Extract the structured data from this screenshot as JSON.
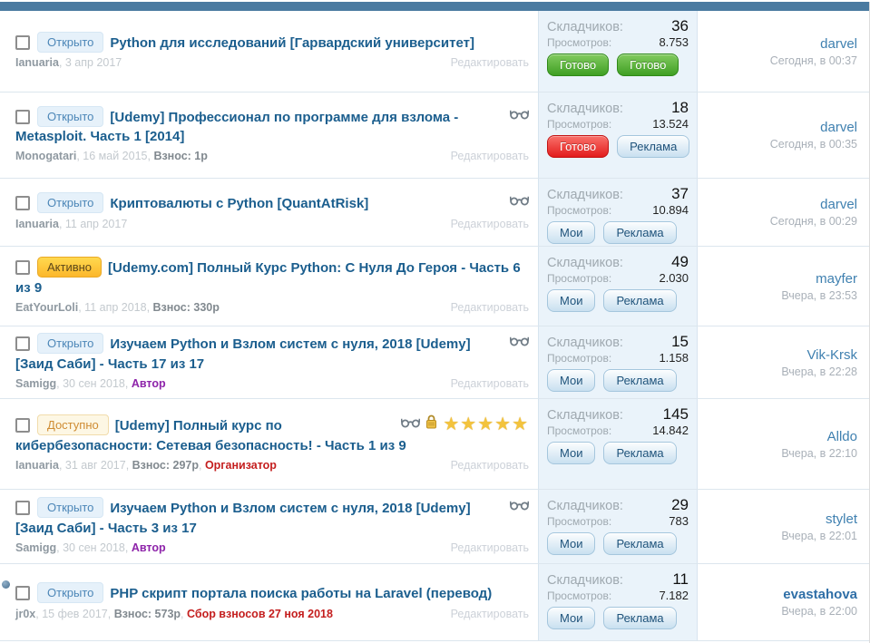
{
  "labels": {
    "skladchikov": "Складчиков:",
    "prosmotrov": "Просмотров:",
    "edit": "Редактировать"
  },
  "colors": {
    "topbar": "#4a7aa0",
    "title_link": "#1b5e8e",
    "username_link": "#3f80b0",
    "stats_bg": "#eaf3fa",
    "status_open_text": "#4d87b8",
    "status_active_bg": "#fcc53d",
    "status_available_text": "#cf8c33",
    "button_green": "#3f9f23",
    "button_red": "#e31c1c",
    "star_gold": "#f3c33d"
  },
  "threads": [
    {
      "unread": false,
      "status": "Открыто",
      "status_type": "open",
      "title": "Python для исследований [Гарвардский университет]",
      "icons": [],
      "meta": [
        {
          "text": "Ianuaria",
          "style": "author"
        },
        {
          "text": ", 3 апр 2017",
          "style": "date"
        }
      ],
      "stats": {
        "skladchikov": "36",
        "prosmotrov": "8.753"
      },
      "buttons": [
        {
          "label": "Готово",
          "style": "green"
        },
        {
          "label": "Готово",
          "style": "green"
        }
      ],
      "user": "darvel",
      "user_bold": false,
      "time": "Сегодня, в 00:37"
    },
    {
      "unread": false,
      "status": "Открыто",
      "status_type": "open",
      "title": "[Udemy] Профессионал по программе для взлома - Metasploit. Часть 1 [2014]",
      "icons": [
        {
          "type": "glasses"
        }
      ],
      "meta": [
        {
          "text": "Monogatari",
          "style": "author"
        },
        {
          "text": ", 16 май 2015, ",
          "style": "date"
        },
        {
          "text": "Взнос: 1р",
          "style": "vznos"
        }
      ],
      "stats": {
        "skladchikov": "18",
        "prosmotrov": "13.524"
      },
      "buttons": [
        {
          "label": "Готово",
          "style": "red"
        },
        {
          "label": "Реклама",
          "style": "blue"
        }
      ],
      "user": "darvel",
      "user_bold": false,
      "time": "Сегодня, в 00:35"
    },
    {
      "unread": false,
      "status": "Открыто",
      "status_type": "open",
      "title": "Криптовалюты с Python [QuantAtRisk]",
      "icons": [
        {
          "type": "glasses"
        }
      ],
      "meta": [
        {
          "text": "Ianuaria",
          "style": "author"
        },
        {
          "text": ", 11 апр 2017",
          "style": "date"
        }
      ],
      "stats": {
        "skladchikov": "37",
        "prosmotrov": "10.894"
      },
      "buttons": [
        {
          "label": "Мои",
          "style": "blue"
        },
        {
          "label": "Реклама",
          "style": "blue"
        }
      ],
      "user": "darvel",
      "user_bold": false,
      "time": "Сегодня, в 00:29"
    },
    {
      "unread": false,
      "status": "Активно",
      "status_type": "active",
      "title": "[Udemy.com] Полный Курс Python: С Нуля До Героя - Часть 6 из 9",
      "icons": [],
      "meta": [
        {
          "text": "EatYourLoli",
          "style": "author"
        },
        {
          "text": ", 11 апр 2018, ",
          "style": "date"
        },
        {
          "text": "Взнос: 330р",
          "style": "vznos"
        }
      ],
      "stats": {
        "skladchikov": "49",
        "prosmotrov": "2.030"
      },
      "buttons": [
        {
          "label": "Мои",
          "style": "blue"
        },
        {
          "label": "Реклама",
          "style": "blue"
        }
      ],
      "user": "mayfer",
      "user_bold": false,
      "time": "Вчера, в 23:53"
    },
    {
      "unread": false,
      "status": "Открыто",
      "status_type": "open",
      "title": "Изучаем Python и Взлом систем с нуля, 2018 [Udemy] [Заид Саби] - Часть 17 из 17",
      "icons": [
        {
          "type": "glasses"
        }
      ],
      "meta": [
        {
          "text": "Samigg",
          "style": "author"
        },
        {
          "text": ", 30 сен 2018, ",
          "style": "date"
        },
        {
          "text": "Автор",
          "style": "purple"
        }
      ],
      "stats": {
        "skladchikov": "15",
        "prosmotrov": "1.158"
      },
      "buttons": [
        {
          "label": "Мои",
          "style": "blue"
        },
        {
          "label": "Реклама",
          "style": "blue"
        }
      ],
      "user": "Vik-Krsk",
      "user_bold": false,
      "time": "Вчера, в 22:28"
    },
    {
      "unread": false,
      "status": "Доступно",
      "status_type": "available",
      "title": "[Udemy] Полный курс по кибербезопасности: Сетевая безопасность! - Часть 1 из 9",
      "icons": [
        {
          "type": "glasses"
        },
        {
          "type": "lock"
        },
        {
          "type": "stars",
          "count": 5
        }
      ],
      "meta": [
        {
          "text": "Ianuaria",
          "style": "author"
        },
        {
          "text": ", 31 авг 2017, ",
          "style": "date"
        },
        {
          "text": "Взнос: 297р",
          "style": "vznos"
        },
        {
          "text": ", ",
          "style": "date"
        },
        {
          "text": "Организатор",
          "style": "red"
        }
      ],
      "stats": {
        "skladchikov": "145",
        "prosmotrov": "14.842"
      },
      "buttons": [
        {
          "label": "Мои",
          "style": "blue"
        },
        {
          "label": "Реклама",
          "style": "blue"
        }
      ],
      "user": "Alldo",
      "user_bold": false,
      "time": "Вчера, в 22:10"
    },
    {
      "unread": false,
      "status": "Открыто",
      "status_type": "open",
      "title": "Изучаем Python и Взлом систем с нуля, 2018 [Udemy] [Заид Саби] - Часть 3 из 17",
      "icons": [
        {
          "type": "glasses"
        }
      ],
      "meta": [
        {
          "text": "Samigg",
          "style": "author"
        },
        {
          "text": ", 30 сен 2018, ",
          "style": "date"
        },
        {
          "text": "Автор",
          "style": "purple"
        }
      ],
      "stats": {
        "skladchikov": "29",
        "prosmotrov": "783"
      },
      "buttons": [
        {
          "label": "Мои",
          "style": "blue"
        },
        {
          "label": "Реклама",
          "style": "blue"
        }
      ],
      "user": "stylet",
      "user_bold": false,
      "time": "Вчера, в 22:01"
    },
    {
      "unread": true,
      "status": "Открыто",
      "status_type": "open",
      "title": "PHP скрипт портала поиска работы на Laravel (перевод)",
      "icons": [],
      "meta": [
        {
          "text": "jr0x",
          "style": "author"
        },
        {
          "text": ", 15 фев 2017, ",
          "style": "date"
        },
        {
          "text": "Взнос: 573р",
          "style": "vznos"
        },
        {
          "text": ", ",
          "style": "date"
        },
        {
          "text": "Сбор взносов 27 ноя 2018",
          "style": "red"
        }
      ],
      "stats": {
        "skladchikov": "11",
        "prosmotrov": "7.182"
      },
      "buttons": [
        {
          "label": "Мои",
          "style": "blue"
        },
        {
          "label": "Реклама",
          "style": "blue"
        }
      ],
      "user": "evastahova",
      "user_bold": true,
      "time": "Вчера, в 22:00"
    }
  ]
}
